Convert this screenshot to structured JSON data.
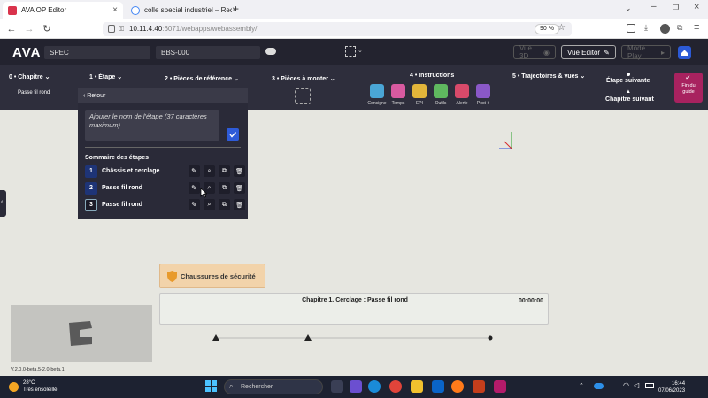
{
  "browser": {
    "tabs": [
      {
        "title": "AVA OP Editor",
        "active": true
      },
      {
        "title": "colle special industriel – Reche",
        "active": false
      }
    ],
    "url_host": "10.11.4.40",
    "url_rest": ":6071/webapps/webassembly/",
    "zoom": "90 %"
  },
  "header": {
    "logo": "AVA",
    "field_left": "SPEC",
    "field_mid": "BBS-000",
    "vue3d_label": "Vue 3D",
    "vue_editor_label": "Vue Editor",
    "mode_play_label": "Mode Play"
  },
  "steps_bar": {
    "chapitre": "0 • Chapitre",
    "chapitre_sub": "Passe fil rond",
    "etape": "1 • Étape",
    "pieces_ref": "2 • Pièces de référence",
    "pieces_monter": "3 • Pièces à monter",
    "instructions": "4 • Instructions",
    "instr_items": [
      "Consigne",
      "Temps",
      "EPI",
      "Outils",
      "Alerte",
      "Post-it"
    ],
    "instr_colors": [
      "#4aa6d6",
      "#d85aa0",
      "#e2b53a",
      "#5fb85f",
      "#d84a6a",
      "#8a58c8"
    ],
    "trajectoires": "5 • Trajectoires & vues",
    "etape_suivante": "Étape suivante",
    "chapitre_suivant": "Chapitre suivant",
    "fin_guide_1": "Fin du",
    "fin_guide_2": "guide"
  },
  "panel": {
    "retour": "Retour",
    "input_placeholder": "Ajouter le nom de l'étape (37 caractères maximum)",
    "summary_title": "Sommaire des étapes",
    "steps": [
      {
        "num": "1",
        "label": "Châssis et cerclage"
      },
      {
        "num": "2",
        "label": "Passe fil rond"
      },
      {
        "num": "3",
        "label": "Passe fil rond"
      }
    ]
  },
  "workspace": {
    "epi_label": "Chaussures de sécurité",
    "chapter_text": "Chapitre 1. Cerclage : Passe fil rond",
    "timer": "00:00:00",
    "version": "V.2.0.0-beta.5-2.0-beta.1"
  },
  "taskbar": {
    "temperature": "28°C",
    "weather": "Très ensoleillé",
    "search_placeholder": "Rechercher",
    "time": "16:44",
    "date": "07/06/2023"
  }
}
